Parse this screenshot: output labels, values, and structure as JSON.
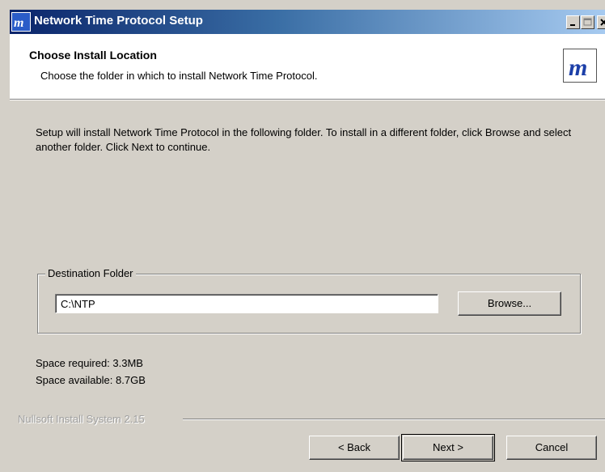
{
  "window": {
    "title": "Network Time Protocol Setup"
  },
  "header": {
    "title": "Choose Install Location",
    "subtitle": "Choose the folder in which to install Network Time Protocol.",
    "logo_icon": "nsis-m-logo-icon"
  },
  "body": {
    "intro_text": "Setup will install Network Time Protocol in the following folder. To install in a different folder, click Browse and select another folder. Click Next to continue.",
    "destination_group_label": "Destination Folder",
    "destination_path": "C:\\NTP",
    "browse_label": "Browse...",
    "space_required": "Space required: 3.3MB",
    "space_available": "Space available: 8.7GB"
  },
  "footer": {
    "branding": "Nullsoft Install System 2.15",
    "back_label": "< Back",
    "next_label": "Next >",
    "cancel_label": "Cancel"
  },
  "colors": {
    "titlebar_start": "#0a246a",
    "titlebar_end": "#a6caf0",
    "dialog_face": "#d4d0c8",
    "logo_blue": "#1c3fa8"
  }
}
